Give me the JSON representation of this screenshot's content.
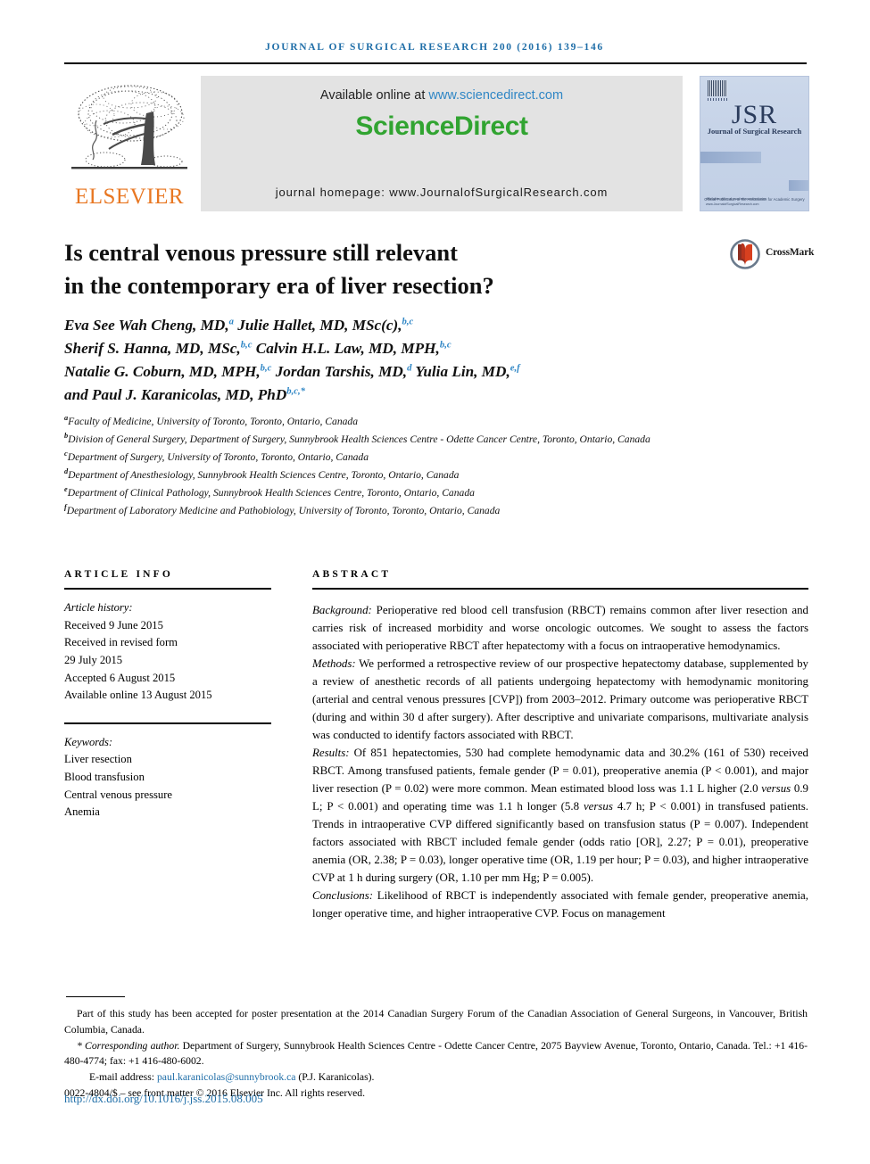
{
  "running_head": "JOURNAL OF SURGICAL RESEARCH 200 (2016) 139–146",
  "masthead": {
    "publisher_name": "ELSEVIER",
    "available_online_prefix": "Available online at ",
    "sciencedirect_url": "www.sciencedirect.com",
    "sciencedirect_logo": "ScienceDirect",
    "journal_homepage": "journal homepage: www.JournalofSurgicalResearch.com",
    "cover": {
      "acronym": "JSR",
      "subtitle": "Journal of Surgical Research",
      "note": "Official Publication of the Association for Academic Surgery",
      "footer": "Available online at www.sciencedirect.com  www.JournalofSurgicalResearch.com"
    }
  },
  "crossmark": {
    "label": "CrossMark"
  },
  "title": {
    "line1": "Is central venous pressure still relevant",
    "line2": "in the contemporary era of liver resection?"
  },
  "authors_html": "Eva See Wah Cheng, MD,<sup>a</sup> Julie Hallet, MD, MSc(c),<sup>b,c</sup><br>Sherif S. Hanna, MD, MSc,<sup>b,c</sup> Calvin H.L. Law, MD, MPH,<sup>b,c</sup><br>Natalie G. Coburn, MD, MPH,<sup>b,c</sup> Jordan Tarshis, MD,<sup>d</sup> Yulia Lin, MD,<sup>e,f</sup><br>and Paul J. Karanicolas, MD, PhD<sup>b,c,*</sup>",
  "affiliations": [
    {
      "mark": "a",
      "text": "Faculty of Medicine, University of Toronto, Toronto, Ontario, Canada"
    },
    {
      "mark": "b",
      "text": "Division of General Surgery, Department of Surgery, Sunnybrook Health Sciences Centre - Odette Cancer Centre, Toronto, Ontario, Canada"
    },
    {
      "mark": "c",
      "text": "Department of Surgery, University of Toronto, Toronto, Ontario, Canada"
    },
    {
      "mark": "d",
      "text": "Department of Anesthesiology, Sunnybrook Health Sciences Centre, Toronto, Ontario, Canada"
    },
    {
      "mark": "e",
      "text": "Department of Clinical Pathology, Sunnybrook Health Sciences Centre, Toronto, Ontario, Canada"
    },
    {
      "mark": "f",
      "text": "Department of Laboratory Medicine and Pathobiology, University of Toronto, Toronto, Ontario, Canada"
    }
  ],
  "article_info": {
    "heading": "ARTICLE INFO",
    "history_label": "Article history:",
    "history": [
      "Received 9 June 2015",
      "Received in revised form",
      "29 July 2015",
      "Accepted 6 August 2015",
      "Available online 13 August 2015"
    ],
    "keywords_label": "Keywords:",
    "keywords": [
      "Liver resection",
      "Blood transfusion",
      "Central venous pressure",
      "Anemia"
    ]
  },
  "abstract": {
    "heading": "ABSTRACT",
    "sections": [
      {
        "label": "Background:",
        "text": " Perioperative red blood cell transfusion (RBCT) remains common after liver resection and carries risk of increased morbidity and worse oncologic outcomes. We sought to assess the factors associated with perioperative RBCT after hepatectomy with a focus on intraoperative hemodynamics."
      },
      {
        "label": "Methods:",
        "text": " We performed a retrospective review of our prospective hepatectomy database, supplemented by a review of anesthetic records of all patients undergoing hepatectomy with hemodynamic monitoring (arterial and central venous pressures [CVP]) from 2003–2012. Primary outcome was perioperative RBCT (during and within 30 d after surgery). After descriptive and univariate comparisons, multivariate analysis was conducted to identify factors associated with RBCT."
      },
      {
        "label": "Results:",
        "html": " Of 851 hepatectomies, 530 had complete hemodynamic data and 30.2% (161 of 530) received RBCT. Among transfused patients, female gender (P = 0.01), preoperative anemia (P &lt; 0.001), and major liver resection (P = 0.02) were more common. Mean estimated blood loss was 1.1 L higher (2.0 <em>versus</em> 0.9 L; P &lt; 0.001) and operating time was 1.1 h longer (5.8 <em>versus</em> 4.7 h; P &lt; 0.001) in transfused patients. Trends in intraoperative CVP differed significantly based on transfusion status (P = 0.007). Independent factors associated with RBCT included female gender (odds ratio [OR], 2.27; P = 0.01), preoperative anemia (OR, 2.38; P = 0.03), longer operative time (OR, 1.19 per hour; P = 0.03), and higher intraoperative CVP at 1 h during surgery (OR, 1.10 per mm Hg; P = 0.005)."
      },
      {
        "label": "Conclusions:",
        "text": " Likelihood of RBCT is independently associated with female gender, preoperative anemia, longer operative time, and higher intraoperative CVP. Focus on management"
      }
    ]
  },
  "footnotes": {
    "poster": "Part of this study has been accepted for poster presentation at the 2014 Canadian Surgery Forum of the Canadian Association of General Surgeons, in Vancouver, British Columbia, Canada.",
    "corresponding_label": "* Corresponding author.",
    "corresponding_text": " Department of Surgery, Sunnybrook Health Sciences Centre - Odette Cancer Centre, 2075 Bayview Avenue, Toronto, Ontario, Canada. Tel.: +1 416-480-4774; fax: +1 416-480-6002.",
    "email_label": "E-mail address: ",
    "email": "paul.karanicolas@sunnybrook.ca",
    "email_suffix": " (P.J. Karanicolas).",
    "copyright": "0022-4804/$ – see front matter © 2016 Elsevier Inc. All rights reserved.",
    "doi": "http://dx.doi.org/10.1016/j.jss.2015.08.005"
  },
  "colors": {
    "link": "#1f6ea8",
    "sciencedirect_green": "#31a431",
    "elsevier_orange": "#e87722",
    "banner_gray": "#e3e3e3"
  }
}
